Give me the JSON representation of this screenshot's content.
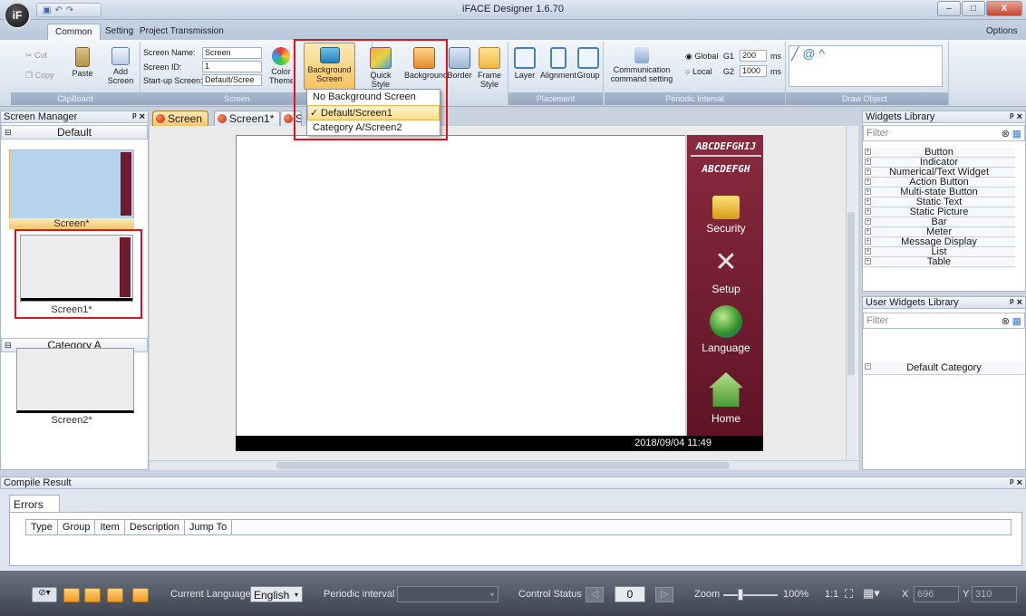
{
  "window": {
    "title": "iFACE Designer 1.6.70",
    "minimize": "–",
    "maximize": "□",
    "close": "X",
    "logo": "iF"
  },
  "qat": {
    "icons": [
      "save-icon",
      "undo-icon",
      "redo-icon"
    ]
  },
  "tabs": [
    {
      "label": "Common"
    },
    {
      "label": "Setting"
    },
    {
      "label": "Project Transmission"
    }
  ],
  "options_label": "Options",
  "ribbon": {
    "clipboard": {
      "label": "ClipBoard",
      "cut": "Cut",
      "copy": "Copy",
      "paste": "Paste"
    },
    "screen": {
      "label": "Screen",
      "add_screen": "Add Screen",
      "name_label": "Screen Name:",
      "name_value": "Screen",
      "id_label": "Screen ID:",
      "id_value": "1",
      "startup_label": "Start-up Screen:",
      "startup_value": "Default/Scree",
      "color_theme": "Color Theme"
    },
    "background_screen": "Background Screen",
    "quick_style": "Quick Style",
    "background": "Background",
    "border": "Border",
    "frame_style": "Frame Style",
    "placement": {
      "label": "Placement",
      "layer": "Layer",
      "alignment": "Alignment",
      "group": "Group"
    },
    "periodic": {
      "label": "Periodic Interval",
      "comm": "Communication command setting",
      "global_label": "Global",
      "g1": "G1",
      "g1_value": "200",
      "local_label": "Local",
      "g2": "G2",
      "g2_value": "1000",
      "unit": "ms"
    },
    "draw": {
      "label": "Draw Object"
    }
  },
  "dropdown": {
    "items": [
      "No Background Screen",
      "Default/Screen1",
      "Category A/Screen2"
    ],
    "checked": "✓"
  },
  "screen_manager": {
    "title": "Screen Manager",
    "categories": [
      {
        "name": "Default",
        "screens": [
          "Screen*",
          "Screen1*"
        ]
      },
      {
        "name": "Category A",
        "screens": [
          "Screen2*"
        ]
      }
    ]
  },
  "doc_tabs": [
    "Screen",
    "Screen1*",
    "S"
  ],
  "canvas": {
    "lcd1": "ABCDEFGHIJ",
    "lcd2": "ABCDEFGH",
    "security": "Security",
    "setup": "Setup",
    "language": "Language",
    "home": "Home",
    "datetime": "2018/09/04   11:49"
  },
  "widgets_library": {
    "title": "Widgets Library",
    "filter_placeholder": "Filter",
    "items": [
      "Button",
      "Indicator",
      "Numerical/Text Widget",
      "Action Button",
      "Multi-state Button",
      "Static Text",
      "Static Picture",
      "Bar",
      "Meter",
      "Message Display",
      "List",
      "Table"
    ]
  },
  "user_widgets": {
    "title": "User Widgets Library",
    "filter_placeholder": "Filter",
    "category": "Default Category"
  },
  "compile": {
    "title": "Compile Result",
    "tab": "Errors",
    "columns": [
      "Type",
      "Group",
      "Item",
      "Description",
      "Jump To"
    ]
  },
  "bottom": {
    "current_language_label": "Current Language",
    "language_value": "English",
    "periodic_label": "Periodic interval",
    "control_status_label": "Control Status",
    "control_value": "0",
    "zoom_label": "Zoom",
    "zoom_value": "100%",
    "ratio": "1:1",
    "x_label": "X",
    "x_value": "696",
    "y_label": "Y",
    "y_value": "310"
  },
  "colors": {
    "accent": "#f4c56d",
    "highlight": "#e0141b",
    "panel": "#6e1a30"
  }
}
